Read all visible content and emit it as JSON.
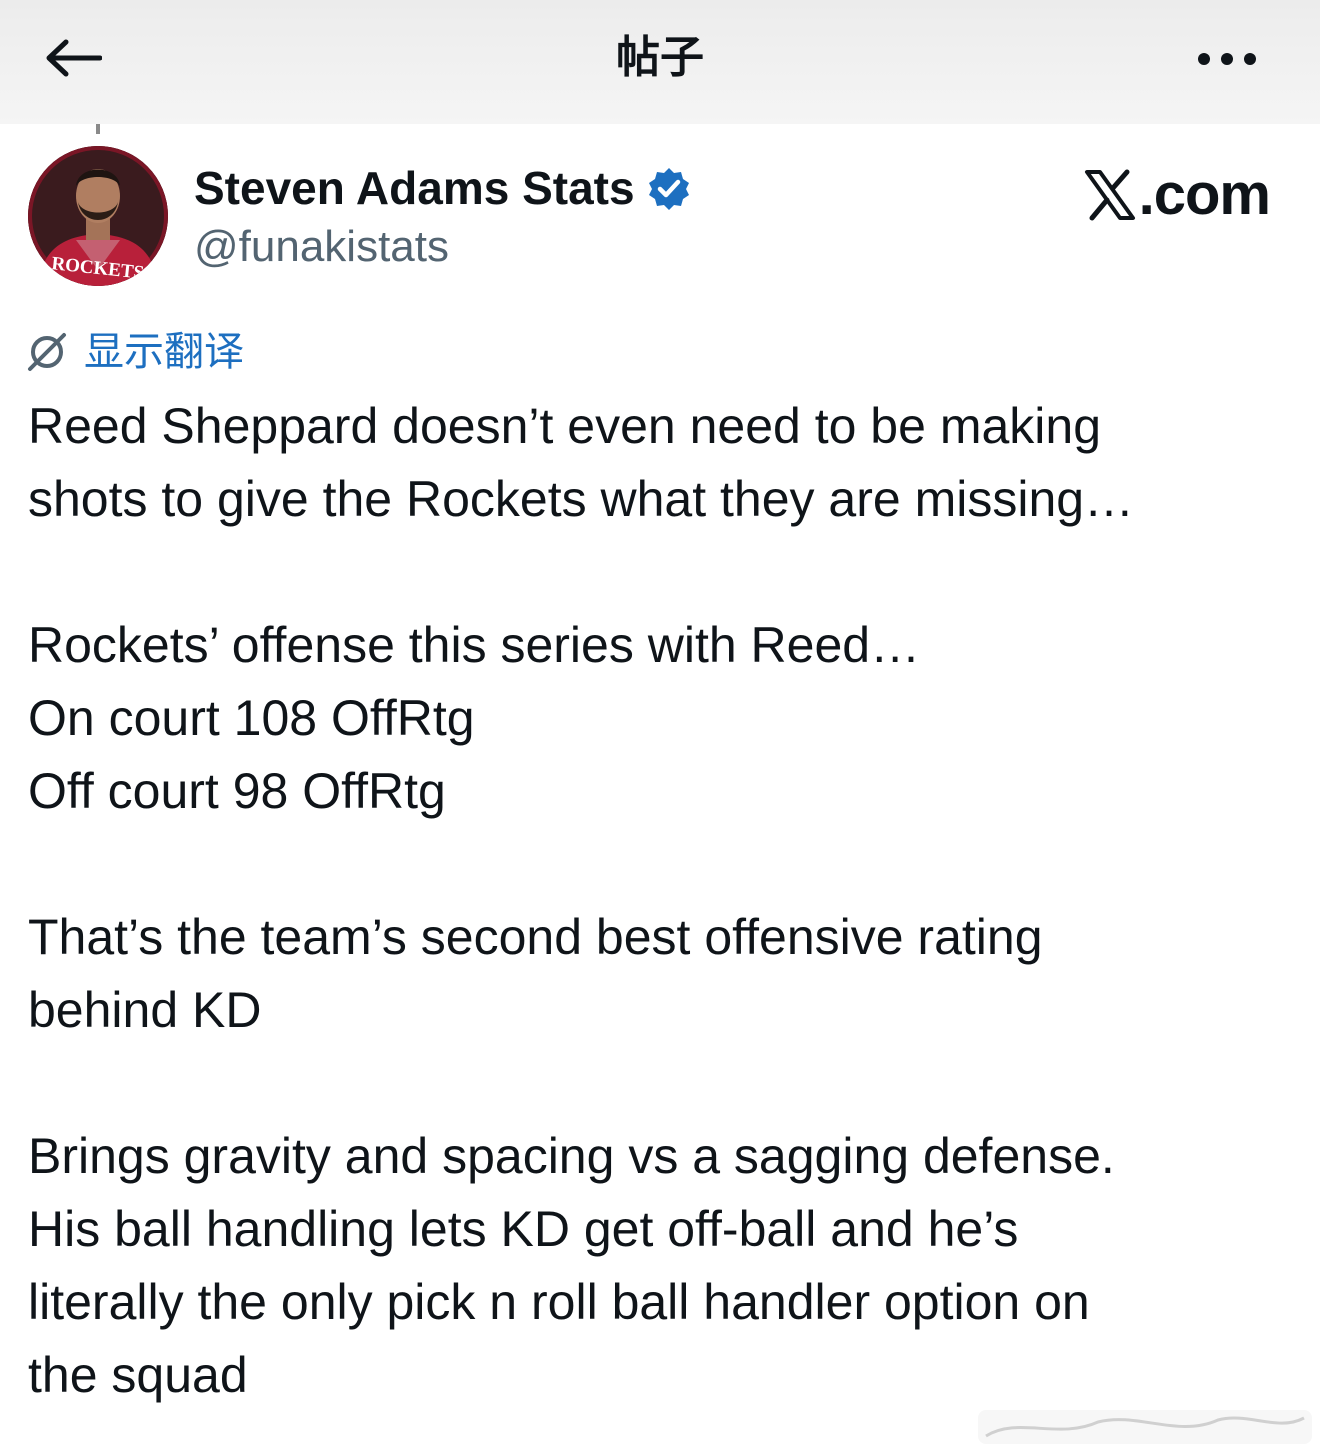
{
  "header": {
    "title": "帖子",
    "back_icon": "arrow-left-icon",
    "more_icon": "more-horizontal-icon"
  },
  "author": {
    "display_name": "Steven Adams Stats",
    "handle": "@funakistats",
    "verified": true,
    "verified_color": "#1d6fc0",
    "avatar_jersey_text": "ROCKETS"
  },
  "brand": {
    "suffix": ".com",
    "logo_icon": "x-logo-icon"
  },
  "translate": {
    "label": "显示翻译",
    "icon": "translate-globe-icon",
    "color": "#1d6fc0"
  },
  "tweet": {
    "lines": [
      "Reed Sheppard doesn’t even need to be making",
      "shots to give the Rockets what they are missing…",
      "",
      "Rockets’ offense this series with Reed…",
      "On court 108 OffRtg",
      "Off court 98 OffRtg",
      "",
      "That’s the team’s second best offensive rating",
      "behind KD",
      "",
      "Brings gravity and spacing vs a sagging defense.",
      "His ball handling lets KD get off-ball and he’s",
      "literally the only pick n roll ball handler option on",
      "the squad"
    ]
  }
}
